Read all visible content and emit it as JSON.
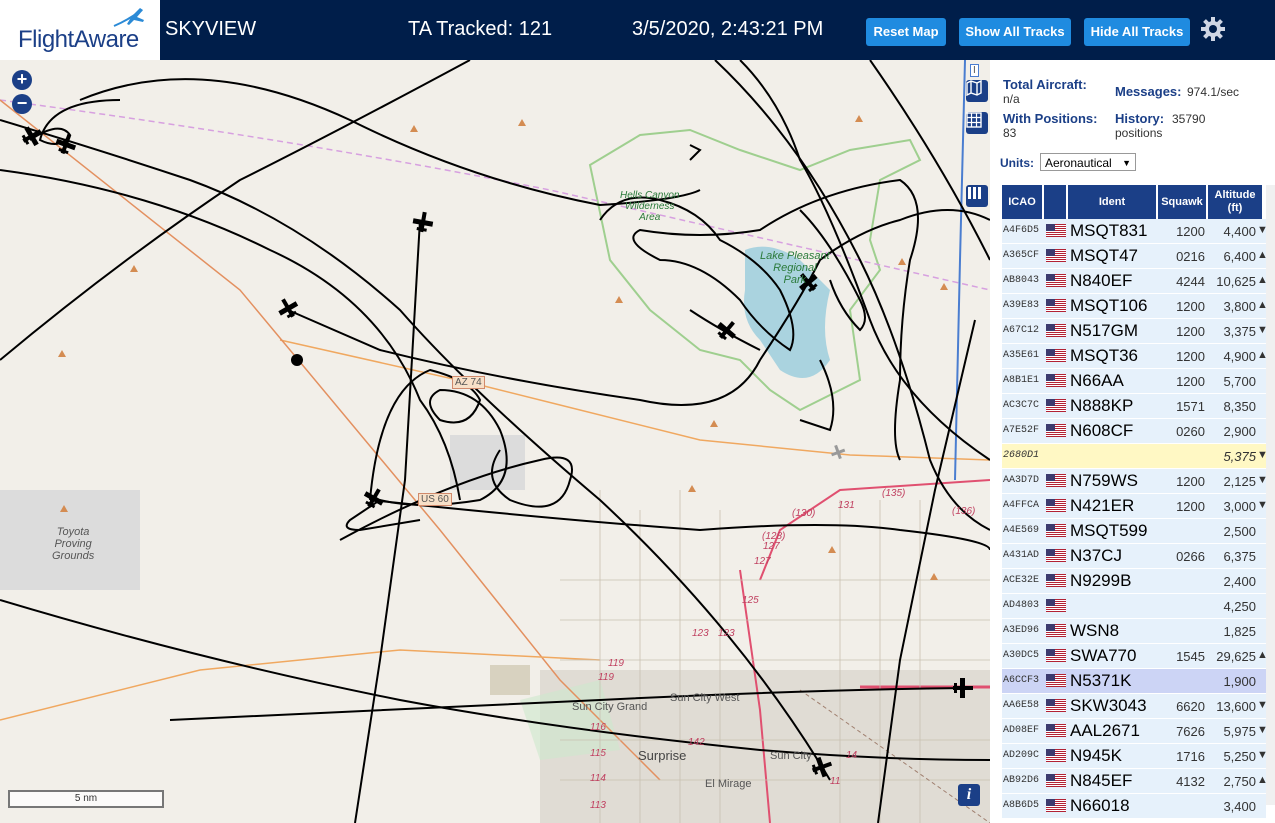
{
  "header": {
    "logo_text": "FlightAware",
    "app_title": "SKYVIEW",
    "tracked": "TA Tracked: 121",
    "datetime": "3/5/2020, 2:43:21 PM",
    "buttons": {
      "reset": "Reset Map",
      "show_all": "Show All Tracks",
      "hide_all": "Hide All Tracks"
    },
    "settings_icon": "gear-icon"
  },
  "stats": {
    "total_aircraft_label": "Total Aircraft:",
    "total_aircraft_value": "n/a",
    "with_positions_label": "With Positions:",
    "with_positions_value": "83",
    "messages_label": "Messages:",
    "messages_value": "974.1/sec",
    "history_label": "History:",
    "history_value": "35790",
    "history_unit": "positions"
  },
  "units": {
    "label": "Units:",
    "selected": "Aeronautical"
  },
  "table": {
    "headers": {
      "icao": "ICAO",
      "ident": "Ident",
      "squawk": "Squawk",
      "altitude": "Altitude",
      "altitude_unit": "(ft)"
    },
    "rows": [
      {
        "icao": "A4F6D5",
        "ident": "MSQT831",
        "squawk": "1200",
        "altitude": "4,400",
        "trend": "▼"
      },
      {
        "icao": "A365CF",
        "ident": "MSQT47",
        "squawk": "0216",
        "altitude": "6,400",
        "trend": "▲"
      },
      {
        "icao": "AB8043",
        "ident": "N840EF",
        "squawk": "4244",
        "altitude": "10,625",
        "trend": "▲"
      },
      {
        "icao": "A39E83",
        "ident": "MSQT106",
        "squawk": "1200",
        "altitude": "3,800",
        "trend": "▲"
      },
      {
        "icao": "A67C12",
        "ident": "N517GM",
        "squawk": "1200",
        "altitude": "3,375",
        "trend": "▼"
      },
      {
        "icao": "A35E61",
        "ident": "MSQT36",
        "squawk": "1200",
        "altitude": "4,900",
        "trend": "▲"
      },
      {
        "icao": "A8B1E1",
        "ident": "N66AA",
        "squawk": "1200",
        "altitude": "5,700",
        "trend": ""
      },
      {
        "icao": "AC3C7C",
        "ident": "N888KP",
        "squawk": "1571",
        "altitude": "8,350",
        "trend": ""
      },
      {
        "icao": "A7E52F",
        "ident": "N608CF",
        "squawk": "0260",
        "altitude": "2,900",
        "trend": ""
      },
      {
        "icao": "2680D1",
        "ident": "",
        "squawk": "",
        "altitude": "5,375",
        "trend": "▼"
      },
      {
        "icao": "AA3D7D",
        "ident": "N759WS",
        "squawk": "1200",
        "altitude": "2,125",
        "trend": "▼"
      },
      {
        "icao": "A4FFCA",
        "ident": "N421ER",
        "squawk": "1200",
        "altitude": "3,000",
        "trend": "▼"
      },
      {
        "icao": "A4E569",
        "ident": "MSQT599",
        "squawk": "",
        "altitude": "2,500",
        "trend": ""
      },
      {
        "icao": "A431AD",
        "ident": "N37CJ",
        "squawk": "0266",
        "altitude": "6,375",
        "trend": ""
      },
      {
        "icao": "ACE32E",
        "ident": "N9299B",
        "squawk": "",
        "altitude": "2,400",
        "trend": ""
      },
      {
        "icao": "AD4803",
        "ident": "",
        "squawk": "",
        "altitude": "4,250",
        "trend": ""
      },
      {
        "icao": "A3ED96",
        "ident": "WSN8",
        "squawk": "",
        "altitude": "1,825",
        "trend": ""
      },
      {
        "icao": "A30DC5",
        "ident": "SWA770",
        "squawk": "1545",
        "altitude": "29,625",
        "trend": "▲"
      },
      {
        "icao": "A6CCF3",
        "ident": "N5371K",
        "squawk": "",
        "altitude": "1,900",
        "trend": ""
      },
      {
        "icao": "AA6E58",
        "ident": "SKW3043",
        "squawk": "6620",
        "altitude": "13,600",
        "trend": "▼"
      },
      {
        "icao": "AD08EF",
        "ident": "AAL2671",
        "squawk": "7626",
        "altitude": "5,975",
        "trend": "▼"
      },
      {
        "icao": "AD209C",
        "ident": "N945K",
        "squawk": "1716",
        "altitude": "5,250",
        "trend": "▼"
      },
      {
        "icao": "AB92D6",
        "ident": "N845EF",
        "squawk": "4132",
        "altitude": "2,750",
        "trend": "▲"
      },
      {
        "icao": "A8B6D5",
        "ident": "N66018",
        "squawk": "",
        "altitude": "3,400",
        "trend": ""
      }
    ]
  },
  "map": {
    "scale_label": "5 nm",
    "zoom_in": "+",
    "zoom_out": "−",
    "labels": {
      "toyota": "Toyota Proving Grounds",
      "toyota_1": "Toyota",
      "toyota_2": "Proving",
      "toyota_3": "Grounds",
      "lake": "Lake Pleasant Regional Park",
      "lake_1": "Lake Pleasant",
      "lake_2": "Regional",
      "lake_3": "Park",
      "hells_1": "Hells Canyon",
      "hells_2": "Wilderness",
      "hells_3": "Area",
      "sun_city_grand": "Sun City Grand",
      "sun_city_west": "Sun City West",
      "surprise": "Surprise",
      "sun_city": "Sun City",
      "el_mirage": "El Mirage",
      "az74": "AZ 74",
      "us60": "US 60",
      "i17": "I"
    },
    "road_numbers": [
      "(130)",
      "131",
      "(135)",
      "(136)",
      "(128)",
      "127",
      "127",
      "125",
      "123",
      "123",
      "119",
      "119",
      "116",
      "115",
      "114",
      "113",
      "142",
      "14",
      "11"
    ]
  }
}
